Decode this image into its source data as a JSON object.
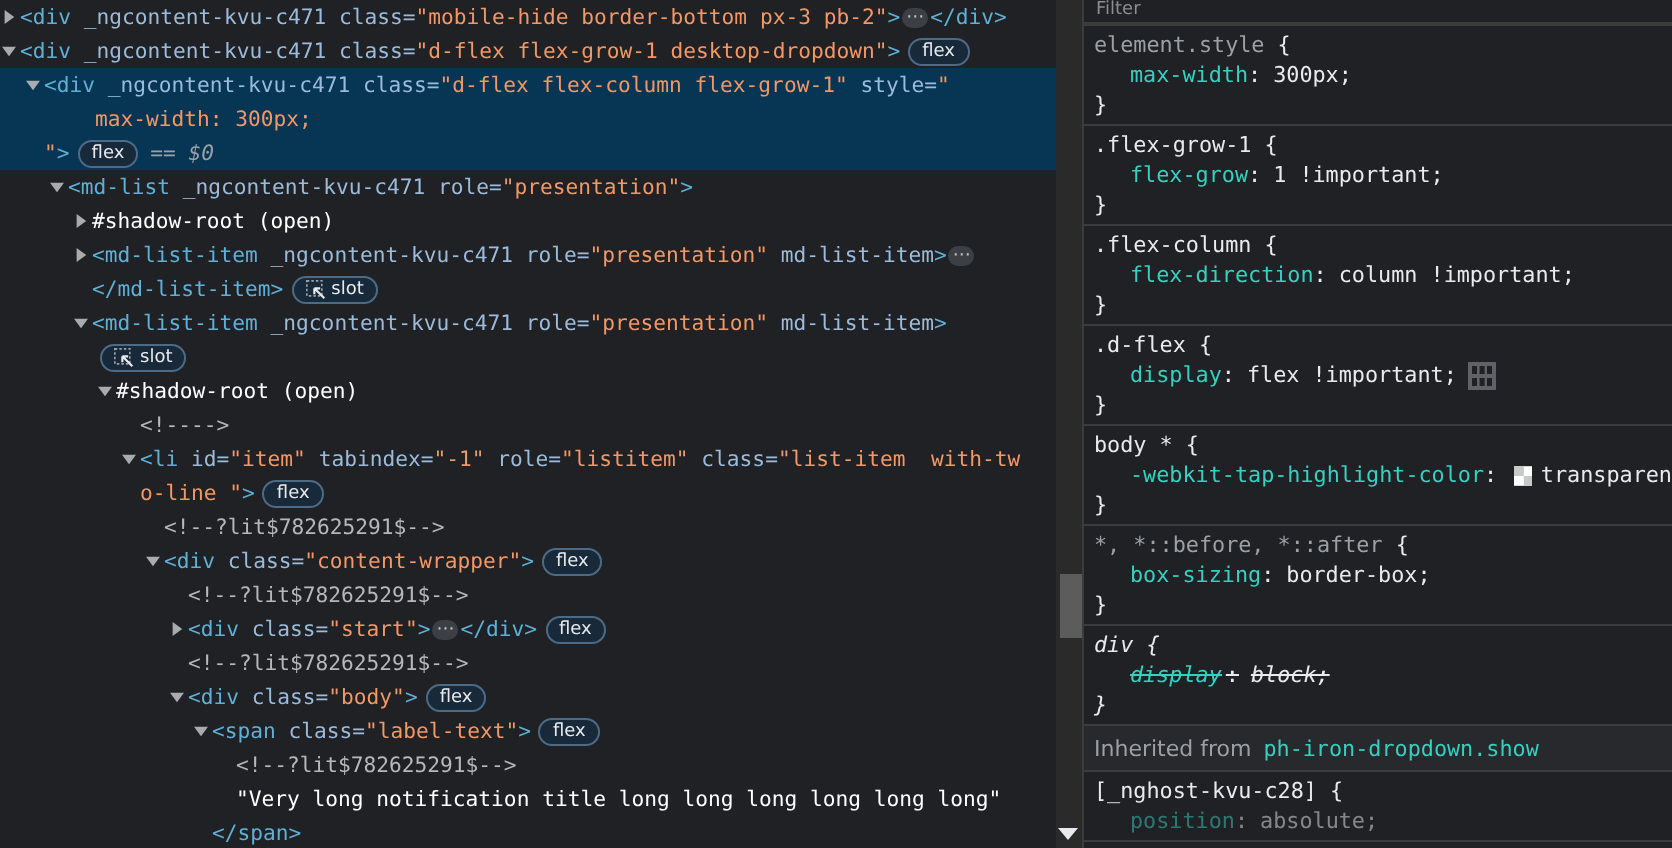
{
  "dom": [
    {
      "expanded": false,
      "selected": false,
      "lines": [
        [
          {
            "kind": "code",
            "parts": [
              {
                "kind": "tag",
                "text": "<div"
              },
              {
                "kind": "attr",
                "text": " _ngcontent-kvu-c471 class="
              },
              {
                "kind": "value",
                "text": "\"mobile-hide border-bottom px-3 pb-2\""
              },
              {
                "kind": "tag",
                "text": ">"
              }
            ]
          },
          {
            "kind": "ellipsis",
            "label": "⋯"
          },
          {
            "kind": "code",
            "parts": [
              {
                "kind": "tag",
                "text": "</div>"
              }
            ]
          }
        ]
      ]
    },
    {
      "expanded": true,
      "selected": false,
      "lines": [
        [
          {
            "kind": "code",
            "parts": [
              {
                "kind": "tag",
                "text": "<div"
              },
              {
                "kind": "attr",
                "text": " _ngcontent-kvu-c471 class="
              },
              {
                "kind": "value",
                "text": "\"d-flex flex-grow-1 desktop-dropdown\""
              },
              {
                "kind": "tag",
                "text": ">"
              }
            ]
          },
          {
            "kind": "badge",
            "label": "flex"
          }
        ]
      ],
      "children": [
        {
          "expanded": true,
          "selected": true,
          "lines": [
            [
              {
                "kind": "code",
                "parts": [
                  {
                    "kind": "tag",
                    "text": "<div"
                  },
                  {
                    "kind": "attr",
                    "text": " _ngcontent-kvu-c471 class="
                  },
                  {
                    "kind": "value",
                    "text": "\"d-flex flex-column flex-grow-1\""
                  },
                  {
                    "kind": "attr",
                    "text": " style="
                  },
                  {
                    "kind": "value",
                    "text": "\""
                  }
                ]
              }
            ],
            [
              {
                "kind": "code",
                "parts": [
                  {
                    "kind": "value",
                    "text": "    max-width: 300px;"
                  }
                ]
              }
            ],
            [
              {
                "kind": "code",
                "parts": [
                  {
                    "kind": "value",
                    "text": "\""
                  },
                  {
                    "kind": "tag",
                    "text": ">"
                  }
                ]
              },
              {
                "kind": "badge",
                "label": "flex"
              },
              {
                "kind": "ref",
                "label": "== $0"
              }
            ]
          ],
          "children": [
            {
              "expanded": true,
              "selected": false,
              "lines": [
                [
                  {
                    "kind": "code",
                    "parts": [
                      {
                        "kind": "tag",
                        "text": "<md-list"
                      },
                      {
                        "kind": "attr",
                        "text": " _ngcontent-kvu-c471 role="
                      },
                      {
                        "kind": "value",
                        "text": "\"presentation\""
                      },
                      {
                        "kind": "tag",
                        "text": ">"
                      }
                    ]
                  }
                ]
              ],
              "children": [
                {
                  "expanded": false,
                  "selected": false,
                  "lines": [
                    [
                      {
                        "kind": "code",
                        "parts": [
                          {
                            "kind": "plain",
                            "text": "#shadow-root (open)"
                          }
                        ]
                      }
                    ]
                  ]
                },
                {
                  "expanded": false,
                  "selected": false,
                  "lines": [
                    [
                      {
                        "kind": "code",
                        "parts": [
                          {
                            "kind": "tag",
                            "text": "<md-list-item"
                          },
                          {
                            "kind": "attr",
                            "text": " _ngcontent-kvu-c471 role="
                          },
                          {
                            "kind": "value",
                            "text": "\"presentation\""
                          },
                          {
                            "kind": "attr",
                            "text": " md-list-item"
                          },
                          {
                            "kind": "tag",
                            "text": ">"
                          }
                        ]
                      },
                      {
                        "kind": "ellipsis",
                        "label": "⋯"
                      }
                    ],
                    [
                      {
                        "kind": "code",
                        "parts": [
                          {
                            "kind": "tag",
                            "text": "</md-list-item>"
                          }
                        ]
                      },
                      {
                        "kind": "slot",
                        "label": "slot"
                      }
                    ]
                  ]
                },
                {
                  "expanded": true,
                  "selected": false,
                  "lines": [
                    [
                      {
                        "kind": "code",
                        "parts": [
                          {
                            "kind": "tag",
                            "text": "<md-list-item"
                          },
                          {
                            "kind": "attr",
                            "text": " _ngcontent-kvu-c471 role="
                          },
                          {
                            "kind": "value",
                            "text": "\"presentation\""
                          },
                          {
                            "kind": "attr",
                            "text": " md-list-item"
                          },
                          {
                            "kind": "tag",
                            "text": ">"
                          }
                        ]
                      }
                    ],
                    [
                      {
                        "kind": "slot",
                        "label": "slot"
                      }
                    ]
                  ],
                  "children": [
                    {
                      "expanded": true,
                      "selected": false,
                      "lines": [
                        [
                          {
                            "kind": "code",
                            "parts": [
                              {
                                "kind": "plain",
                                "text": "#shadow-root (open)"
                              }
                            ]
                          }
                        ]
                      ],
                      "children": [
                        {
                          "selected": false,
                          "lines": [
                            [
                              {
                                "kind": "code",
                                "parts": [
                                  {
                                    "kind": "comment",
                                    "text": "<!---->"
                                  }
                                ]
                              }
                            ]
                          ]
                        },
                        {
                          "expanded": true,
                          "selected": false,
                          "lines": [
                            [
                              {
                                "kind": "code",
                                "parts": [
                                  {
                                    "kind": "tag",
                                    "text": "<li"
                                  },
                                  {
                                    "kind": "attr",
                                    "text": " id="
                                  },
                                  {
                                    "kind": "value",
                                    "text": "\"item\""
                                  },
                                  {
                                    "kind": "attr",
                                    "text": " tabindex="
                                  },
                                  {
                                    "kind": "value",
                                    "text": "\"-1\""
                                  },
                                  {
                                    "kind": "attr",
                                    "text": " role="
                                  },
                                  {
                                    "kind": "value",
                                    "text": "\"listitem\""
                                  },
                                  {
                                    "kind": "attr",
                                    "text": " class="
                                  },
                                  {
                                    "kind": "value",
                                    "text": "\"list-item  with-tw"
                                  }
                                ]
                              }
                            ],
                            [
                              {
                                "kind": "code",
                                "parts": [
                                  {
                                    "kind": "value",
                                    "text": "o-line \""
                                  },
                                  {
                                    "kind": "tag",
                                    "text": ">"
                                  }
                                ]
                              },
                              {
                                "kind": "badge",
                                "label": "flex"
                              }
                            ]
                          ],
                          "children": [
                            {
                              "selected": false,
                              "lines": [
                                [
                                  {
                                    "kind": "code",
                                    "parts": [
                                      {
                                        "kind": "comment",
                                        "text": "<!--?lit$782625291$-->"
                                      }
                                    ]
                                  }
                                ]
                              ]
                            },
                            {
                              "expanded": true,
                              "selected": false,
                              "lines": [
                                [
                                  {
                                    "kind": "code",
                                    "parts": [
                                      {
                                        "kind": "tag",
                                        "text": "<div"
                                      },
                                      {
                                        "kind": "attr",
                                        "text": " class="
                                      },
                                      {
                                        "kind": "value",
                                        "text": "\"content-wrapper\""
                                      },
                                      {
                                        "kind": "tag",
                                        "text": ">"
                                      }
                                    ]
                                  },
                                  {
                                    "kind": "badge",
                                    "label": "flex"
                                  }
                                ]
                              ],
                              "children": [
                                {
                                  "selected": false,
                                  "lines": [
                                    [
                                      {
                                        "kind": "code",
                                        "parts": [
                                          {
                                            "kind": "comment",
                                            "text": "<!--?lit$782625291$-->"
                                          }
                                        ]
                                      }
                                    ]
                                  ]
                                },
                                {
                                  "expanded": false,
                                  "selected": false,
                                  "lines": [
                                    [
                                      {
                                        "kind": "code",
                                        "parts": [
                                          {
                                            "kind": "tag",
                                            "text": "<div"
                                          },
                                          {
                                            "kind": "attr",
                                            "text": " class="
                                          },
                                          {
                                            "kind": "value",
                                            "text": "\"start\""
                                          },
                                          {
                                            "kind": "tag",
                                            "text": ">"
                                          }
                                        ]
                                      },
                                      {
                                        "kind": "ellipsis",
                                        "label": "⋯"
                                      },
                                      {
                                        "kind": "code",
                                        "parts": [
                                          {
                                            "kind": "tag",
                                            "text": "</div>"
                                          }
                                        ]
                                      },
                                      {
                                        "kind": "badge",
                                        "label": "flex"
                                      }
                                    ]
                                  ]
                                },
                                {
                                  "selected": false,
                                  "lines": [
                                    [
                                      {
                                        "kind": "code",
                                        "parts": [
                                          {
                                            "kind": "comment",
                                            "text": "<!--?lit$782625291$-->"
                                          }
                                        ]
                                      }
                                    ]
                                  ]
                                },
                                {
                                  "expanded": true,
                                  "selected": false,
                                  "lines": [
                                    [
                                      {
                                        "kind": "code",
                                        "parts": [
                                          {
                                            "kind": "tag",
                                            "text": "<div"
                                          },
                                          {
                                            "kind": "attr",
                                            "text": " class="
                                          },
                                          {
                                            "kind": "value",
                                            "text": "\"body\""
                                          },
                                          {
                                            "kind": "tag",
                                            "text": ">"
                                          }
                                        ]
                                      },
                                      {
                                        "kind": "badge",
                                        "label": "flex"
                                      }
                                    ]
                                  ],
                                  "children": [
                                    {
                                      "expanded": true,
                                      "selected": false,
                                      "lines": [
                                        [
                                          {
                                            "kind": "code",
                                            "parts": [
                                              {
                                                "kind": "tag",
                                                "text": "<span"
                                              },
                                              {
                                                "kind": "attr",
                                                "text": " class="
                                              },
                                              {
                                                "kind": "value",
                                                "text": "\"label-text\""
                                              },
                                              {
                                                "kind": "tag",
                                                "text": ">"
                                              }
                                            ]
                                          },
                                          {
                                            "kind": "badge",
                                            "label": "flex"
                                          }
                                        ]
                                      ],
                                      "children": [
                                        {
                                          "selected": false,
                                          "lines": [
                                            [
                                              {
                                                "kind": "code",
                                                "parts": [
                                                  {
                                                    "kind": "comment",
                                                    "text": "<!--?lit$782625291$-->"
                                                  }
                                                ]
                                              }
                                            ]
                                          ]
                                        },
                                        {
                                          "selected": false,
                                          "lines": [
                                            [
                                              {
                                                "kind": "code",
                                                "parts": [
                                                  {
                                                    "kind": "plain",
                                                    "text": "\"Very long notification title long long long long long long\""
                                                  }
                                                ]
                                              }
                                            ]
                                          ]
                                        }
                                      ],
                                      "close": {
                                        "kind": "code",
                                        "parts": [
                                          {
                                            "kind": "tag",
                                            "text": "</span>"
                                          }
                                        ]
                                      }
                                    }
                                  ]
                                }
                              ]
                            }
                          ]
                        }
                      ]
                    }
                  ]
                }
              ]
            }
          ]
        }
      ]
    }
  ],
  "styles": {
    "filter": {
      "placeholder": "Filter"
    },
    "rules": [
      {
        "kind": "inline",
        "selector": "element.style",
        "open": "{",
        "close": "}",
        "declarations": [
          {
            "kind": "plain",
            "property": "max-width",
            "sep": ":",
            "value": "300px;",
            "overridden": false
          }
        ]
      },
      {
        "kind": "author",
        "selector": ".flex-grow-1",
        "open": "{",
        "close": "}",
        "declarations": [
          {
            "kind": "plain",
            "property": "flex-grow",
            "sep": ":",
            "value": "1 !important;",
            "overridden": false
          }
        ]
      },
      {
        "kind": "author",
        "selector": ".flex-column",
        "open": "{",
        "close": "}",
        "declarations": [
          {
            "kind": "plain",
            "property": "flex-direction",
            "sep": ":",
            "value": "column !important;",
            "overridden": false
          }
        ]
      },
      {
        "kind": "author",
        "selector": ".d-flex",
        "open": "{",
        "close": "}",
        "declarations": [
          {
            "kind": "flex-editor",
            "property": "display",
            "sep": ":",
            "value": "flex !important;",
            "overridden": false
          }
        ]
      },
      {
        "kind": "author",
        "selector": "body *",
        "open": "{",
        "close": "}",
        "declarations": [
          {
            "kind": "swatch",
            "property": "-webkit-tap-highlight-color",
            "sep": ":",
            "value": "transparen",
            "overridden": false
          }
        ]
      },
      {
        "kind": "pseudo",
        "selector": "*, *::before, *::after",
        "open": "{",
        "close": "}",
        "declarations": [
          {
            "kind": "plain",
            "property": "box-sizing",
            "sep": ":",
            "value": "border-box;",
            "overridden": false
          }
        ]
      },
      {
        "kind": "useragent",
        "selector": "div",
        "open": "{",
        "close": "}",
        "declarations": [
          {
            "kind": "plain",
            "property": "display",
            "sep": ":",
            "value": "block;",
            "overridden": true
          }
        ]
      }
    ],
    "inherited": {
      "label": "Inherited from",
      "source": "ph-iron-dropdown.show"
    },
    "inherited_rules": [
      {
        "kind": "author",
        "selector": "[_nghost-kvu-c28]",
        "open": "{",
        "declarations": [
          {
            "kind": "plain",
            "property": "position",
            "sep": ":",
            "value": "absolute;",
            "overridden": false
          }
        ]
      }
    ]
  }
}
